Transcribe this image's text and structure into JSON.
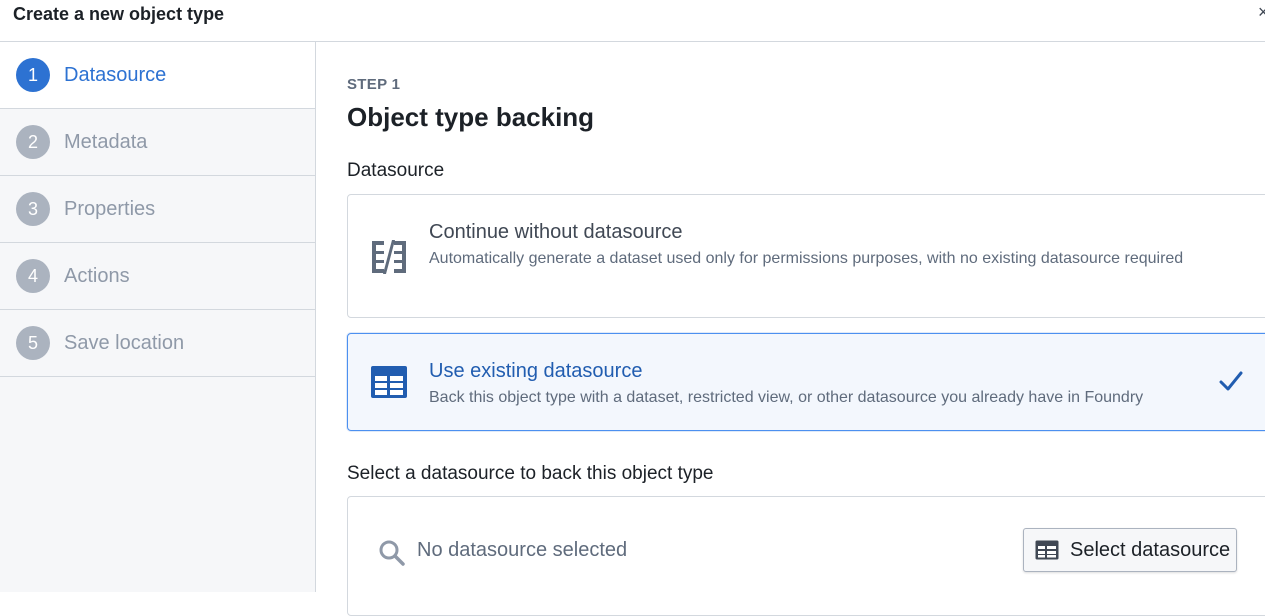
{
  "dialog": {
    "title": "Create a new object type",
    "close_glyph": "×"
  },
  "steps": [
    {
      "number": "1",
      "label": "Datasource",
      "active": true
    },
    {
      "number": "2",
      "label": "Metadata",
      "active": false
    },
    {
      "number": "3",
      "label": "Properties",
      "active": false
    },
    {
      "number": "4",
      "label": "Actions",
      "active": false
    },
    {
      "number": "5",
      "label": "Save location",
      "active": false
    }
  ],
  "main": {
    "step_kicker": "STEP 1",
    "heading": "Object type backing",
    "datasource_label": "Datasource",
    "options": [
      {
        "title": "Continue without datasource",
        "description": "Automatically generate a dataset used only for permissions purposes, with no existing datasource required",
        "icon": "split-columns-icon",
        "selected": false
      },
      {
        "title": "Use existing datasource",
        "description": "Back this object type with a dataset, restricted view, or other datasource you already have in Foundry",
        "icon": "table-icon",
        "selected": true
      }
    ],
    "select_label": "Select a datasource to back this object type",
    "selector": {
      "placeholder": "No datasource selected",
      "button_label": "Select datasource",
      "search_icon": "search-icon",
      "button_icon": "table-icon"
    }
  },
  "colors": {
    "accent": "#2d72d2",
    "selected_bg": "#f3f7fd",
    "muted": "#abb3bf",
    "sidebar_bg": "#f6f7f9"
  }
}
